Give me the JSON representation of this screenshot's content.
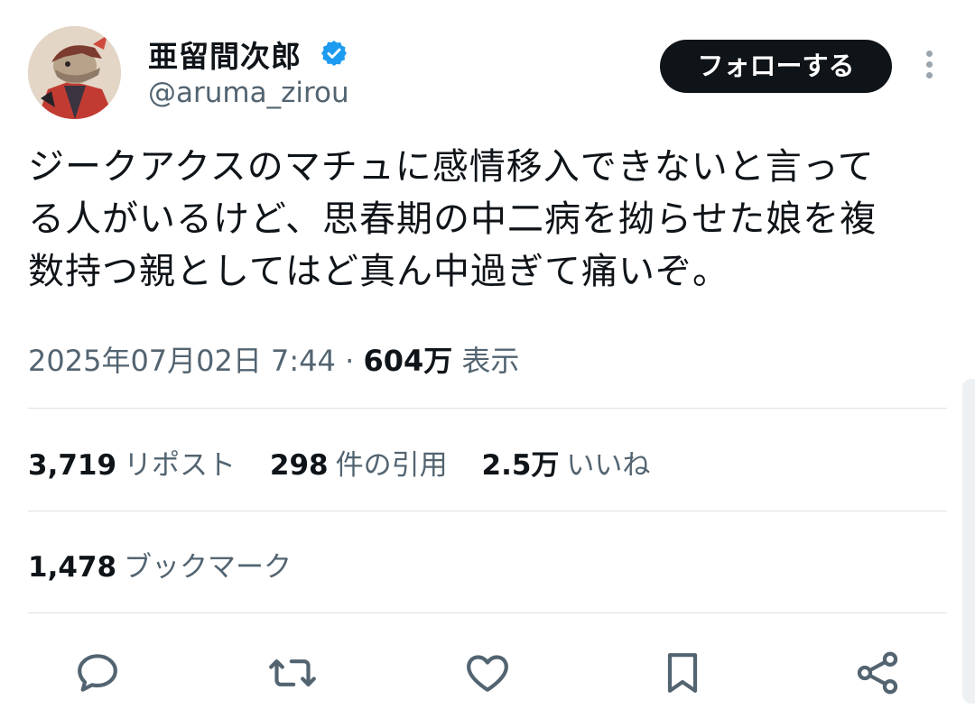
{
  "author": {
    "display_name": "亜留間次郎",
    "handle": "@aruma_zirou",
    "verified": true,
    "avatar_icon": "user-avatar"
  },
  "header": {
    "follow_label": "フォローする",
    "more_icon": "more-vertical-icon"
  },
  "tweet": {
    "lines": [
      "ジークアクスのマチュに感情移入できないと言って",
      "る人がいるけど、思春期の中二病を拗らせた娘を複",
      "数持つ親としてはど真ん中過ぎて痛いぞ。"
    ],
    "datetime": "2025年07月02日 7:44",
    "separator": "·",
    "views_count": "604万",
    "views_label": "表示"
  },
  "stats": {
    "reposts_count": "3,719",
    "reposts_label": "リポスト",
    "quotes_count": "298",
    "quotes_label": "件の引用",
    "likes_count": "2.5万",
    "likes_label": "いいね",
    "bookmarks_count": "1,478",
    "bookmarks_label": "ブックマーク"
  },
  "actions": [
    "reply-icon",
    "repost-icon",
    "like-icon",
    "bookmark-icon",
    "share-icon"
  ],
  "colors": {
    "text": "#0f1419",
    "secondary": "#536471",
    "verified": "#1d9bf0",
    "divider": "#dbe2e7",
    "button_bg": "#0f1419"
  }
}
